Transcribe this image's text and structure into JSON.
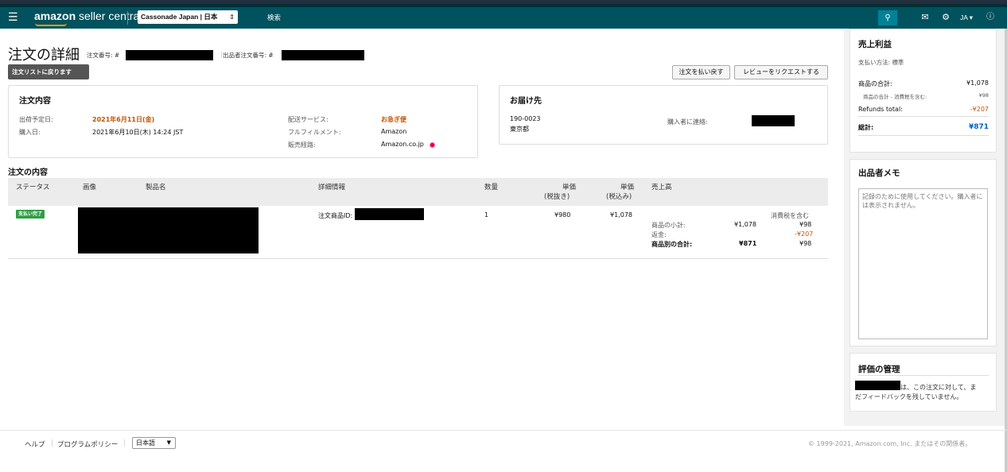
{
  "topbar": {
    "menu_icon": "hamburger-icon",
    "logo_amazon": "amazon",
    "logo_rest": " seller central",
    "store_selector": "Cassonade  Japan | 日本",
    "search_placeholder": "検索",
    "lang": "JA ▾"
  },
  "order": {
    "title": "注文の詳細",
    "order_number_label": "注文番号: #",
    "seller_order_label": "出品者注文番号: #",
    "back_button": "注文リストに戻ります",
    "refund_button": "注文を払い戻す",
    "review_button": "レビューをリクエストする"
  },
  "order_info": {
    "heading": "注文内容",
    "ship_by_label": "出荷予定日:",
    "ship_by_value": "2021年6月11日(金)",
    "purchase_date_label": "購入日:",
    "purchase_date_value": "2021年6月10日(木) 14:24 JST",
    "shipping_service_label": "配送サービス:",
    "shipping_service_value": "お急ぎ便",
    "fulfillment_label": "フルフィルメント:",
    "fulfillment_value": "Amazon",
    "sales_channel_label": "販売経路:",
    "sales_channel_value": "Amazon.co.jp"
  },
  "ship_to": {
    "heading": "お届け先",
    "postal": "190-0023",
    "prefecture": "東京都",
    "contact_label": "購入者に連絡:"
  },
  "items": {
    "heading": "注文の内容",
    "columns": {
      "status": "ステータス",
      "image": "画像",
      "product": "製品名",
      "details": "詳細情報",
      "qty": "数量",
      "unit_ex": "単価",
      "unit_ex_sub": "(税抜き)",
      "unit_in": "単価",
      "unit_in_sub": "(税込み)",
      "sales": "売上高"
    },
    "row": {
      "status": "支払い完了",
      "order_item_label": "注文商品ID:",
      "qty": "1",
      "unit_ex": "¥980",
      "unit_in": "¥1,078",
      "tax_header": "消費税を含む",
      "subtotal_label": "商品の小計:",
      "subtotal": "¥1,078",
      "subtotal_tax": "¥98",
      "refund_label": "返金:",
      "refund_tax": "-¥207",
      "item_total_label": "商品別の合計:",
      "item_total": "¥871",
      "item_total_tax": "¥98"
    }
  },
  "sidebar": {
    "profit_heading": "売上利益",
    "payment_method": "支払い方法: 標準",
    "product_total_label": "商品の合計:",
    "product_total": "¥1,078",
    "tax_note_label": "商品の合計 - 消費税を含む:",
    "tax_note": "¥98",
    "refunds_label": "Refunds total:",
    "refunds": "-¥207",
    "grand_label": "総計:",
    "grand": "¥871",
    "memo_heading": "出品者メモ",
    "memo_placeholder": "記録のために使用してください。購入者には表示されません。",
    "feedback_heading": "評価の管理",
    "feedback_text_1": "は、この注文に対して、ま",
    "feedback_text_2": "だフィードバックを残していません。"
  },
  "footer": {
    "help": "ヘルプ",
    "policy": "プログラムポリシー",
    "language": "日本語",
    "copyright": "© 1999-2021, Amazon.com, Inc. またはその関係者。"
  },
  "colors": {
    "topbar": "#00525e",
    "accent_orange": "#c45500",
    "status_green": "#2f9e44",
    "link_blue": "#0066c0"
  }
}
